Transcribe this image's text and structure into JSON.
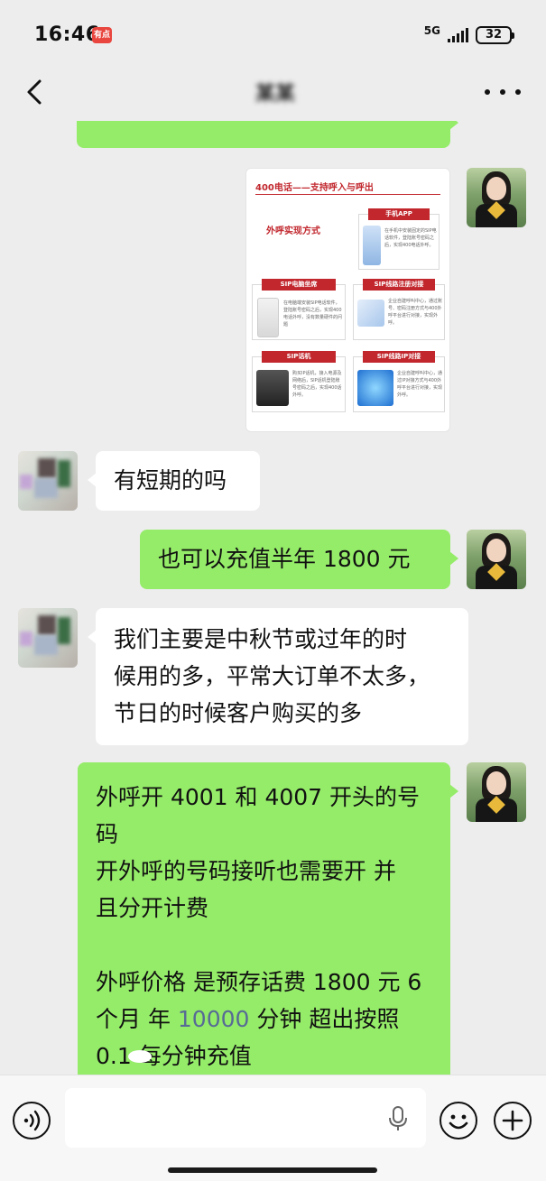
{
  "status_bar": {
    "time": "16:46",
    "app_badge": "有点",
    "network": "5G",
    "battery": "32"
  },
  "header": {
    "title": "某某"
  },
  "messages": [
    {
      "side": "right",
      "type": "text",
      "text": ""
    },
    {
      "side": "right",
      "type": "image",
      "image": {
        "title": "400电话——支持呼入与呼出",
        "subtitle": "外呼实现方式",
        "cards": [
          {
            "label": "手机APP",
            "text": "在手机中安装固定的SIP电话软件，登陆账号密码之后，实现400电话外呼。"
          },
          {
            "label": "SIP电脑坐席",
            "text": "在电脑端安装SIP电话软件，登陆账号密码之后，实现400电话外呼，没有数量硬件的问题"
          },
          {
            "label": "SIP线路注册对接",
            "text": "企业自建呼叫中心，通过账号、密码注册方式与400外呼平台进行对接，实现外呼。"
          },
          {
            "label": "SIP话机",
            "text": "购买IP话机，接入电源及网络后，SIP话机登陆账号密码之后，实现400话外呼。"
          },
          {
            "label": "SIP线路IP对接",
            "text": "企业自建呼叫中心，通过IP对接方式与400外呼平台进行对接，实现外呼。"
          }
        ]
      }
    },
    {
      "side": "left",
      "type": "text",
      "text": "有短期的吗"
    },
    {
      "side": "right",
      "type": "text",
      "text": "也可以充值半年 1800 元"
    },
    {
      "side": "left",
      "type": "text",
      "lines": [
        "我们主要是中秋节或过年的时",
        "候用的多，平常大订单不太多，",
        "节日的时候客户购买的多"
      ]
    },
    {
      "side": "right",
      "type": "text",
      "lines": [
        "外呼开 4001 和 4007 开头的号",
        "码",
        "开外呼的号码接听也需要开  并",
        "且分开计费",
        "",
        "外呼价格 是预存话费 1800 元 6"
      ],
      "line7_pre": "个月  年 ",
      "line7_highlight": "10000",
      "line7_post": " 分钟  超出按照",
      "line8": "0.1  每分钟充值"
    }
  ],
  "colors": {
    "green_bubble": "#95ec69",
    "white_bubble": "#ffffff",
    "background": "#ededed",
    "highlight_text": "#576b95",
    "image_red": "#c1272d"
  },
  "input_bar": {
    "placeholder": "",
    "icons": [
      "voice-icon",
      "mic-icon",
      "emoji-icon",
      "plus-icon"
    ]
  }
}
